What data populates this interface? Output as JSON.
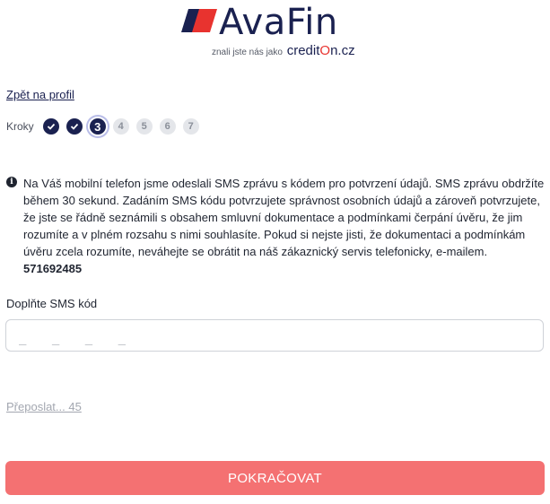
{
  "logo": {
    "text": "AvaFin",
    "tagline": "znali jste nás jako",
    "brand_prefix": "credit",
    "brand_o": "O",
    "brand_suffix": "n.cz"
  },
  "nav": {
    "back_label": "Zpět na profil"
  },
  "steps": {
    "label": "Kroky",
    "items": [
      {
        "status": "done",
        "text": ""
      },
      {
        "status": "done",
        "text": ""
      },
      {
        "status": "current",
        "text": "3"
      },
      {
        "status": "future",
        "text": "4"
      },
      {
        "status": "future",
        "text": "5"
      },
      {
        "status": "future",
        "text": "6"
      },
      {
        "status": "future",
        "text": "7"
      }
    ]
  },
  "info": {
    "message": "Na Váš mobilní telefon jsme odeslali SMS zprávu s kódem pro potvrzení údajů. SMS zprávu obdržíte během 30 sekund. Zadáním SMS kódu potvrzujete správnost osobních údajů a zároveň potvrzujete, že jste se řádně seznámili s obsahem smluvní dokumentace a podmínkami čerpání úvěru, že jim rozumíte a v plném rozsahu s nimi souhlasíte. Pokud si nejste jisti, že dokumentaci a podmínkám úvěru zcela rozumíte, neváhejte se obrátit na náš zákaznický servis telefonicky, e-mailem.",
    "phone": "571692485"
  },
  "sms": {
    "label": "Doplňte SMS kód",
    "placeholder": "_ _ _ _"
  },
  "resend": {
    "label": "Přeposlat... 45"
  },
  "continue": {
    "label": "POKRAČOVAT"
  },
  "colors": {
    "brand_navy": "#1a2150",
    "brand_red": "#e8332f",
    "button": "#f47172",
    "step_future": "#e4e6ea"
  }
}
